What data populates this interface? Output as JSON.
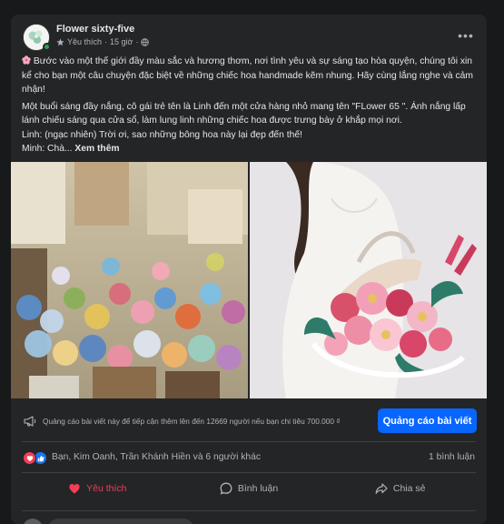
{
  "post": {
    "page_name": "Flower sixty-five",
    "meta_like": "Yêu thích",
    "meta_sep": "·",
    "meta_time": "15 giờ",
    "meta_sep2": "·",
    "more_label": "•••",
    "paragraph1": "Bước vào một thế giới đầy màu sắc và hương thơm, nơi tình yêu và sự sáng tạo hòa quyện, chúng tôi xin kể cho bạn một câu chuyện đặc biệt về những chiếc hoa handmade kẽm nhung. Hãy cùng lắng nghe và cảm nhận!",
    "paragraph2": "Một buổi sáng đầy nắng, cô gái trẻ tên là Linh đến một cửa hàng nhỏ mang tên \"FLower 65 \". Ánh nắng lấp lánh chiếu sáng qua cửa sổ, làm lung linh những chiếc hoa được trưng bày ở khắp mọi nơi.",
    "paragraph3": "Linh: (ngạc nhiên) Trời ơi, sao những bông hoa này lại đẹp đến thế!",
    "paragraph4_prefix": "Minh: Chà... ",
    "see_more": "Xem thêm"
  },
  "boost": {
    "text": "Quảng cáo bài viết này để tiếp cận thêm lên đến 12669 người nếu bạn chi tiêu 700.000 ₫",
    "button_label": "Quảng cáo bài viết"
  },
  "reactions": {
    "names": "Bạn, Kim Oanh, Trần Khánh Hiền và 6 người khác",
    "comment_count": "1 bình luận"
  },
  "actions": {
    "like_label": "Yêu thích",
    "comment_label": "Bình luận",
    "share_label": "Chia sẻ"
  },
  "colors": {
    "background": "#18191a",
    "card": "#242526",
    "primary_text": "#e4e6eb",
    "secondary_text": "#b0b3b8",
    "accent_blue": "#0866ff",
    "love_red": "#f33e58"
  },
  "icons": {
    "privacy": "globe-icon",
    "boost": "megaphone-icon",
    "like": "heart-icon",
    "comment": "comment-icon",
    "share": "share-icon"
  }
}
